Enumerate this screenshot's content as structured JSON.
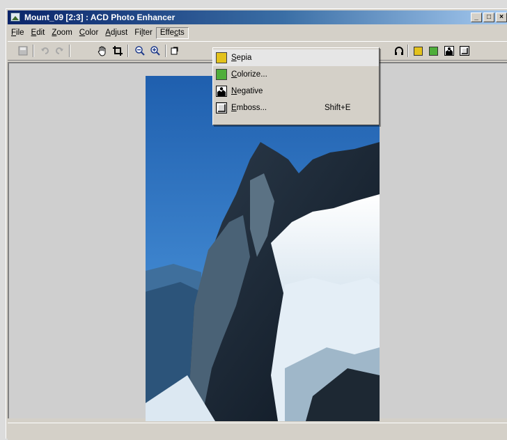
{
  "window": {
    "title": "Mount_09 [2:3] : ACD Photo Enhancer",
    "controls": {
      "minimize": "_",
      "maximize": "□",
      "close": "×"
    }
  },
  "menubar": {
    "items": [
      {
        "label": "File",
        "mnemonic": "F",
        "rest": "ile"
      },
      {
        "label": "Edit",
        "mnemonic": "E",
        "rest": "dit"
      },
      {
        "label": "Zoom",
        "mnemonic": "Z",
        "rest": "oom"
      },
      {
        "label": "Color",
        "mnemonic": "C",
        "rest": "olor"
      },
      {
        "label": "Adjust",
        "mnemonic": "A",
        "rest": "djust"
      },
      {
        "label": "Filter",
        "pre": "Fi",
        "mnemonic": "l",
        "rest": "ter"
      },
      {
        "label": "Effects",
        "pre": "Effe",
        "mnemonic": "c",
        "rest": "ts"
      }
    ]
  },
  "toolbar": {
    "buttons": [
      "save-icon",
      "undo-icon",
      "redo-icon",
      "hand-icon",
      "crop-icon",
      "zoom-out-icon",
      "zoom-in-icon",
      "rotate-icon",
      "headphone-icon",
      "sepia-icon",
      "colorize-icon",
      "negative-icon",
      "emboss-icon"
    ]
  },
  "effects_menu": {
    "items": [
      {
        "label_mnemonic": "S",
        "label_rest": "epia",
        "label": "Sepia",
        "shortcut": "",
        "icon": "sepia-icon",
        "color": "#e3c21c"
      },
      {
        "label_mnemonic": "C",
        "label_rest": "olorize...",
        "label": "Colorize...",
        "shortcut": "",
        "icon": "colorize-icon",
        "color": "#4fae3a"
      },
      {
        "label_mnemonic": "N",
        "label_rest": "egative",
        "label": "Negative",
        "shortcut": "",
        "icon": "negative-icon",
        "color": "#222222"
      },
      {
        "label_mnemonic": "E",
        "label_rest": "mboss...",
        "label": "Emboss...",
        "shortcut": "Shift+E",
        "icon": "emboss-icon",
        "color": "#cfcfcf"
      }
    ]
  },
  "colors": {
    "titlebar_start": "#0a246a",
    "titlebar_end": "#a6caf0",
    "face": "#d4d0c8",
    "workspace": "#cfcfcf"
  }
}
